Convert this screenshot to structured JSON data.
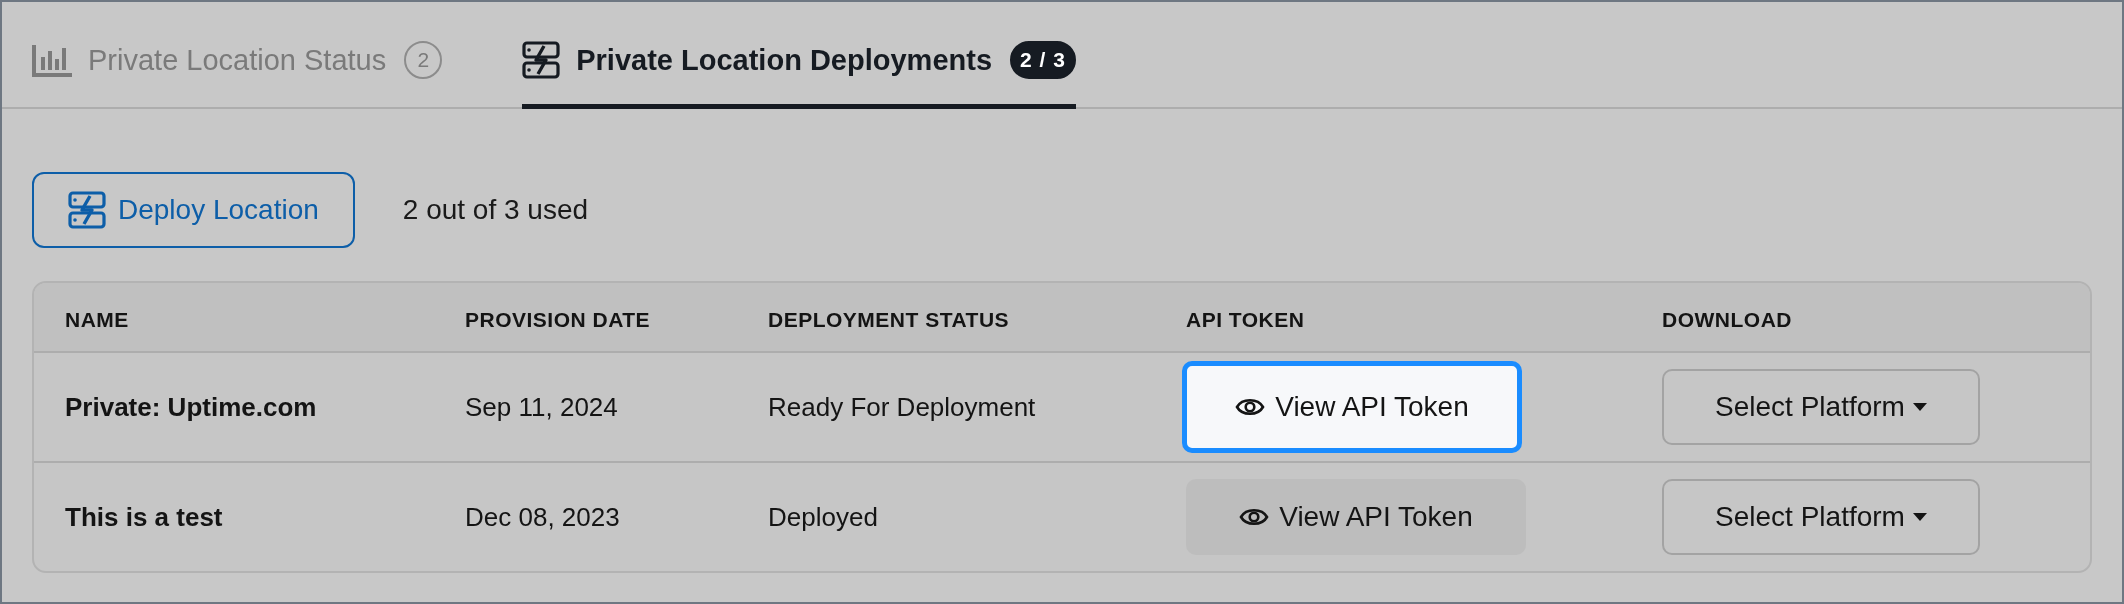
{
  "tabs": [
    {
      "label": "Private Location Status",
      "count": "2",
      "kind": "chart",
      "selected": false
    },
    {
      "label": "Private Location Deployments",
      "count": "2 / 3",
      "kind": "deploy",
      "selected": true
    }
  ],
  "toolbar": {
    "deploy_button": "Deploy Location",
    "usage": "2 out of 3 used"
  },
  "table": {
    "columns": [
      "NAME",
      "PROVISION DATE",
      "DEPLOYMENT STATUS",
      "API TOKEN",
      "DOWNLOAD"
    ],
    "rows": [
      {
        "name": "Private: Uptime.com",
        "provision_date": "Sep 11, 2024",
        "status": "Ready For Deployment",
        "token_button": {
          "label": "View API Token",
          "focused": true
        },
        "download": "Select Platform"
      },
      {
        "name": "This is a test",
        "provision_date": "Dec 08, 2023",
        "status": "Deployed",
        "token_button": {
          "label": "View API Token",
          "focused": false
        },
        "download": "Select Platform"
      }
    ]
  }
}
